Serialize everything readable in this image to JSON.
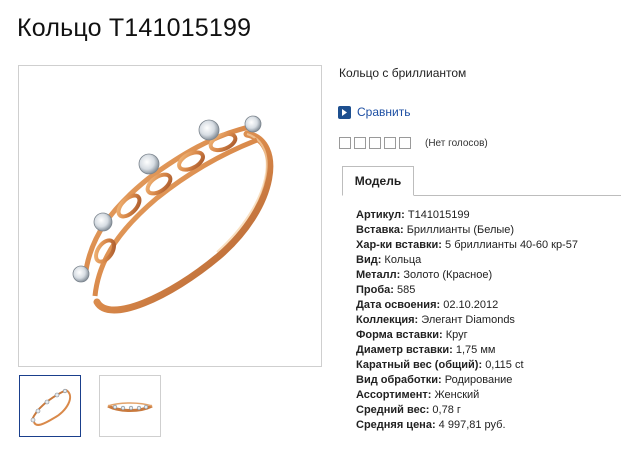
{
  "page": {
    "title": "Кольцо Т141015199",
    "subtitle": "Кольцо с бриллиантом"
  },
  "compare": {
    "label": "Сравнить",
    "icon": "arrow-right-icon",
    "icon_color": "#1d4f8f"
  },
  "rating": {
    "stars": 5,
    "value": 0,
    "votes_label": "(Нет голосов)"
  },
  "tabs": [
    {
      "label": "Модель",
      "active": true
    }
  ],
  "properties": [
    {
      "key": "Артикул:",
      "value": "Т141015199"
    },
    {
      "key": "Вставка:",
      "value": "Бриллианты (Белые)"
    },
    {
      "key": "Хар-ки вставки:",
      "value": "5 бриллианты 40-60 кр-57"
    },
    {
      "key": "Вид:",
      "value": "Кольца"
    },
    {
      "key": "Металл:",
      "value": "Золото (Красное)"
    },
    {
      "key": "Проба:",
      "value": "585"
    },
    {
      "key": "Дата освоения:",
      "value": "02.10.2012"
    },
    {
      "key": "Коллекция:",
      "value": "Элегант Diamonds"
    },
    {
      "key": "Форма вставки:",
      "value": "Круг"
    },
    {
      "key": "Диаметр вставки:",
      "value": "1,75 мм"
    },
    {
      "key": "Каратный вес (общий):",
      "value": "0,115 ct"
    },
    {
      "key": "Вид обработки:",
      "value": "Родирование"
    },
    {
      "key": "Ассортимент:",
      "value": "Женский"
    },
    {
      "key": "Средний вес:",
      "value": "0,78 г"
    },
    {
      "key": "Средняя цена:",
      "value": "4 997,81 руб."
    }
  ],
  "gallery": {
    "main_image": "gold-ring-with-diamonds",
    "thumbnails": [
      {
        "name": "ring-thumbnail-top-view",
        "selected": true
      },
      {
        "name": "ring-thumbnail-side-view",
        "selected": false
      }
    ],
    "colors": {
      "gold": "#d9894a",
      "gold_dark": "#a5562a",
      "selected_border": "#1a3f8c"
    }
  }
}
